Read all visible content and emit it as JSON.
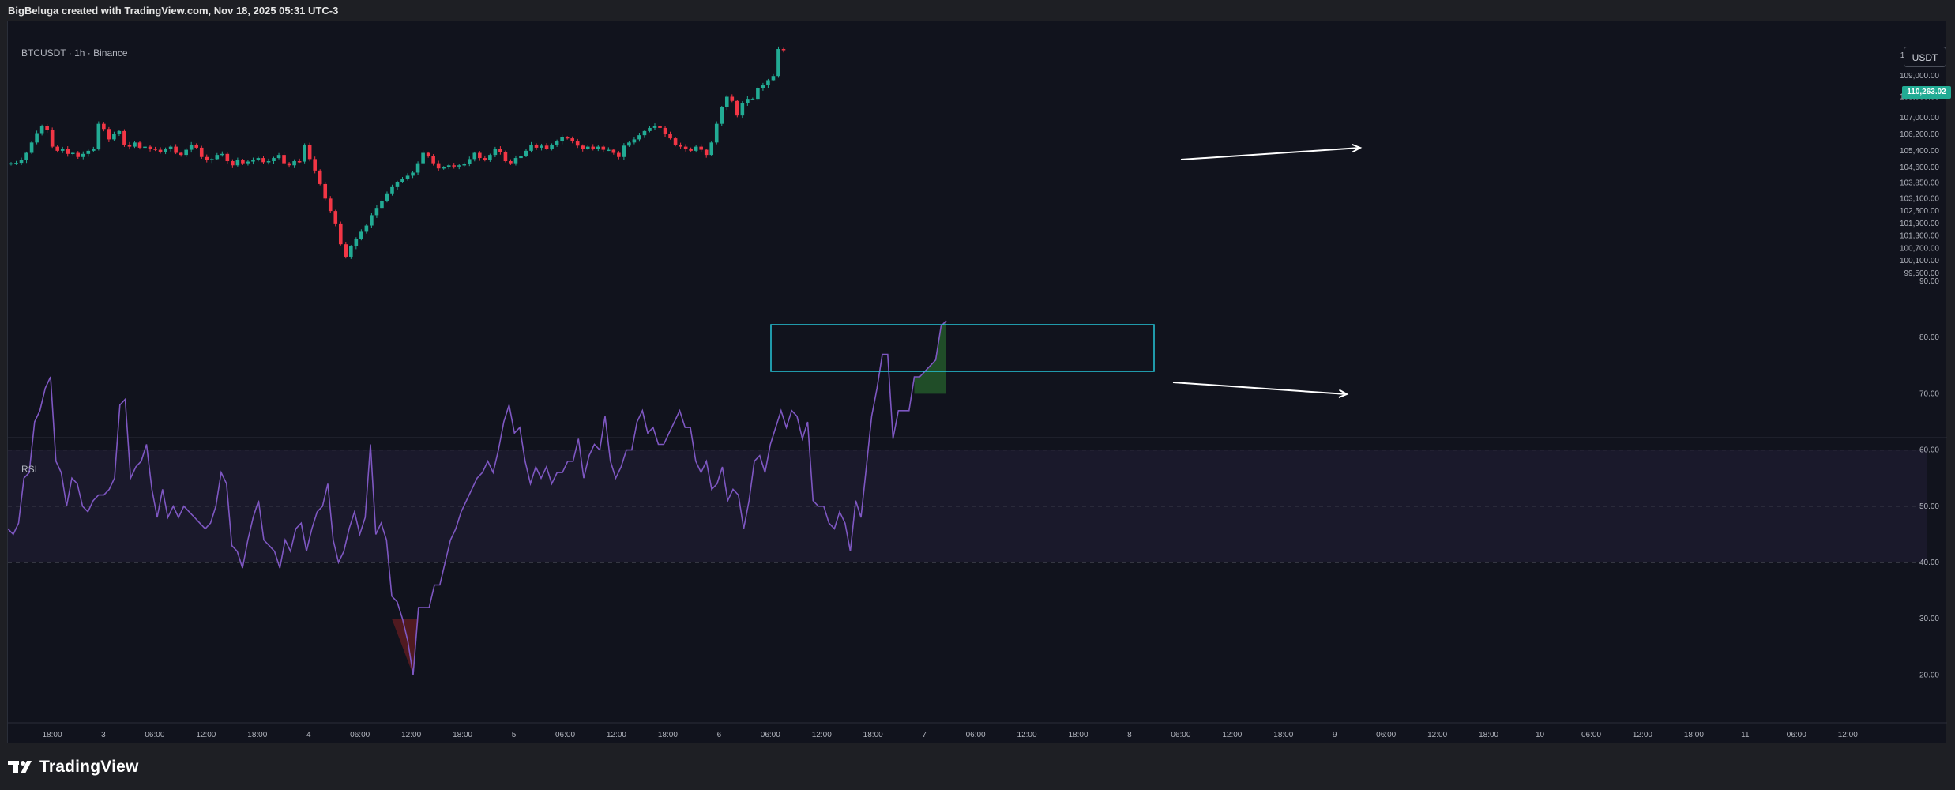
{
  "header": {
    "caption": "BigBeluga created with TradingView.com, Nov 18, 2025 05:31 UTC-3"
  },
  "price_pane": {
    "symbol_label": "BTCUSDT · 1h · Binance",
    "currency_button": "USDT",
    "last_price": "110,263.02",
    "y_axis_ticks": [
      "110,000.00",
      "109,000.00",
      "108,000.00",
      "107,000.00",
      "106,200.00",
      "105,400.00",
      "104,600.00",
      "103,850.00",
      "103,100.00",
      "102,500.00",
      "101,900.00",
      "101,300.00",
      "100,700.00",
      "100,100.00",
      "99,500.00"
    ],
    "up_color": "#22ab94",
    "down_color": "#f23645"
  },
  "rsi_pane": {
    "label": "RSI",
    "y_axis_ticks": [
      "90.00",
      "80.00",
      "70.00",
      "60.00",
      "50.00",
      "40.00",
      "30.00",
      "20.00"
    ],
    "line_color": "#7e57c2",
    "box_color": "#26c6da"
  },
  "time_axis": {
    "ticks": [
      "18:00",
      "3",
      "06:00",
      "12:00",
      "18:00",
      "4",
      "06:00",
      "12:00",
      "18:00",
      "5",
      "06:00",
      "12:00",
      "18:00",
      "6",
      "06:00",
      "12:00",
      "18:00",
      "7",
      "06:00",
      "12:00",
      "18:00",
      "8",
      "06:00",
      "12:00",
      "18:00",
      "9",
      "06:00",
      "12:00",
      "18:00",
      "10",
      "06:00",
      "12:00",
      "18:00",
      "11",
      "06:00",
      "12:00"
    ]
  },
  "footer": {
    "brand": "TradingView"
  },
  "chart_data": [
    {
      "type": "candlestick",
      "series": [
        {
          "name": "BTCUSDT",
          "close": [
            104800,
            104820,
            104950,
            105300,
            105800,
            106250,
            106600,
            106400,
            105600,
            105400,
            105500,
            105250,
            105300,
            105100,
            105250,
            105400,
            105500,
            106700,
            106450,
            105950,
            106200,
            106350,
            105700,
            105600,
            105800,
            105550,
            105600,
            105500,
            105450,
            105350,
            105500,
            105600,
            105300,
            105200,
            105450,
            105700,
            105550,
            105100,
            104950,
            105000,
            105200,
            105250,
            104900,
            104700,
            104950,
            104800,
            104880,
            104950,
            105050,
            104850,
            104900,
            105050,
            105200,
            104800,
            104700,
            104900,
            104880,
            105700,
            105000,
            104450,
            103800,
            103100,
            102500,
            101900,
            100900,
            100300,
            100800,
            101150,
            101500,
            101800,
            102300,
            102650,
            103000,
            103350,
            103650,
            103900,
            104050,
            104200,
            104350,
            104800,
            105300,
            105150,
            104800,
            104550,
            104600,
            104700,
            104650,
            104700,
            104750,
            105000,
            105300,
            105050,
            104950,
            105200,
            105500,
            105350,
            104900,
            104800,
            105050,
            105150,
            105400,
            105700,
            105550,
            105650,
            105500,
            105700,
            105850,
            106050,
            106000,
            105850,
            105650,
            105500,
            105600,
            105500,
            105600,
            105450,
            105450,
            105300,
            105100,
            105650,
            105800,
            105950,
            106150,
            106350,
            106500,
            106600,
            106500,
            106200,
            106000,
            105700,
            105600,
            105500,
            105400,
            105600,
            105450,
            105200,
            105800,
            106700,
            107500,
            108000,
            107800,
            107100,
            107700,
            107900,
            107900,
            108400,
            108550,
            108800,
            109000,
            110300,
            110250
          ]
        }
      ],
      "ylim": [
        99500,
        110263.02
      ]
    },
    {
      "type": "line",
      "series": [
        {
          "name": "RSI",
          "values": [
            46,
            45,
            47,
            55,
            56,
            65,
            67,
            71,
            73,
            58,
            56,
            50,
            55,
            54,
            50,
            49,
            51,
            52,
            52,
            53,
            55,
            68,
            69,
            55,
            57,
            58,
            61,
            53,
            48,
            53,
            48,
            50,
            48,
            50,
            49,
            48,
            47,
            46,
            47,
            50,
            56,
            54,
            43,
            42,
            39,
            44,
            48,
            51,
            44,
            43,
            42,
            39,
            44,
            42,
            46,
            47,
            42,
            46,
            49,
            50,
            54,
            44,
            40,
            42,
            46,
            49,
            45,
            48,
            61,
            45,
            47,
            44,
            34,
            33,
            30,
            26,
            20,
            32,
            32,
            32,
            36,
            36,
            40,
            44,
            46,
            49,
            51,
            53,
            55,
            56,
            58,
            56,
            60,
            65,
            68,
            63,
            64,
            58,
            54,
            57,
            55,
            57,
            54,
            56,
            56,
            58,
            58,
            62,
            55,
            59,
            61,
            60,
            66,
            58,
            55,
            57,
            60,
            60,
            65,
            67,
            63,
            64,
            61,
            61,
            63,
            65,
            67,
            64,
            64,
            58,
            56,
            58,
            53,
            54,
            57,
            51,
            53,
            52,
            46,
            51,
            58,
            59,
            56,
            61,
            64,
            67,
            64,
            67,
            66,
            62,
            65,
            51,
            50,
            50,
            47,
            46,
            49,
            47,
            42,
            51,
            48,
            57,
            66,
            71,
            77,
            77,
            62,
            67,
            67,
            67,
            73,
            73,
            74,
            75,
            76,
            82,
            83
          ]
        }
      ],
      "ylim": [
        15,
        90
      ],
      "levels": [
        60,
        50,
        40
      ]
    }
  ]
}
